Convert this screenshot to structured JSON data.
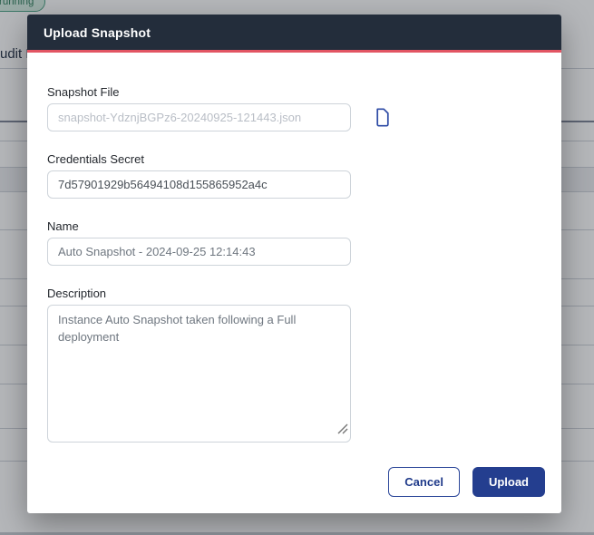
{
  "background": {
    "status_badge_label": "running",
    "nav_text_fragment": "udit L"
  },
  "modal": {
    "title": "Upload Snapshot",
    "fields": {
      "snapshot_file": {
        "label": "Snapshot File",
        "placeholder": "snapshot-YdznjBGPz6-20240925-121443.json",
        "icon": "file-icon"
      },
      "credentials_secret": {
        "label": "Credentials Secret",
        "value": "7d57901929b56494108d155865952a4c"
      },
      "name": {
        "label": "Name",
        "value": "Auto Snapshot - 2024-09-25 12:14:43"
      },
      "description": {
        "label": "Description",
        "value": "Instance Auto Snapshot taken following a Full deployment"
      }
    },
    "buttons": {
      "cancel": "Cancel",
      "upload": "Upload"
    }
  },
  "colors": {
    "header_bg": "#232d3b",
    "accent_red": "#e25563",
    "primary_blue": "#243e8f",
    "icon_blue": "#2d4aa5",
    "badge_green": "#2e7d5b",
    "placeholder_gray": "#b9bec6"
  }
}
